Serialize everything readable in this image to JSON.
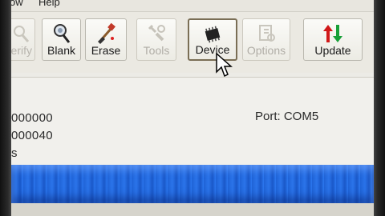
{
  "menu": {
    "items": [
      "ow",
      "Help"
    ]
  },
  "toolbar": {
    "buttons": [
      {
        "label": "erify",
        "icon": "magnifier-icon",
        "enabled": false
      },
      {
        "label": "Blank",
        "icon": "blank-check-icon",
        "enabled": true
      },
      {
        "label": "Erase",
        "icon": "erase-brush-icon",
        "enabled": true
      },
      {
        "label": "Tools",
        "icon": "tools-icon",
        "enabled": false
      },
      {
        "label": "Device",
        "icon": "chip-icon",
        "enabled": true
      },
      {
        "label": "Options",
        "icon": "options-icon",
        "enabled": false
      },
      {
        "label": "Update",
        "icon": "update-arrows-icon",
        "enabled": true
      }
    ]
  },
  "info": {
    "lines": [
      "000000",
      "000040",
      "s"
    ],
    "port": "Port: COM5"
  },
  "colors": {
    "update_up": "#d01818",
    "update_down": "#18a038",
    "progress_blue": "#2268e0"
  }
}
